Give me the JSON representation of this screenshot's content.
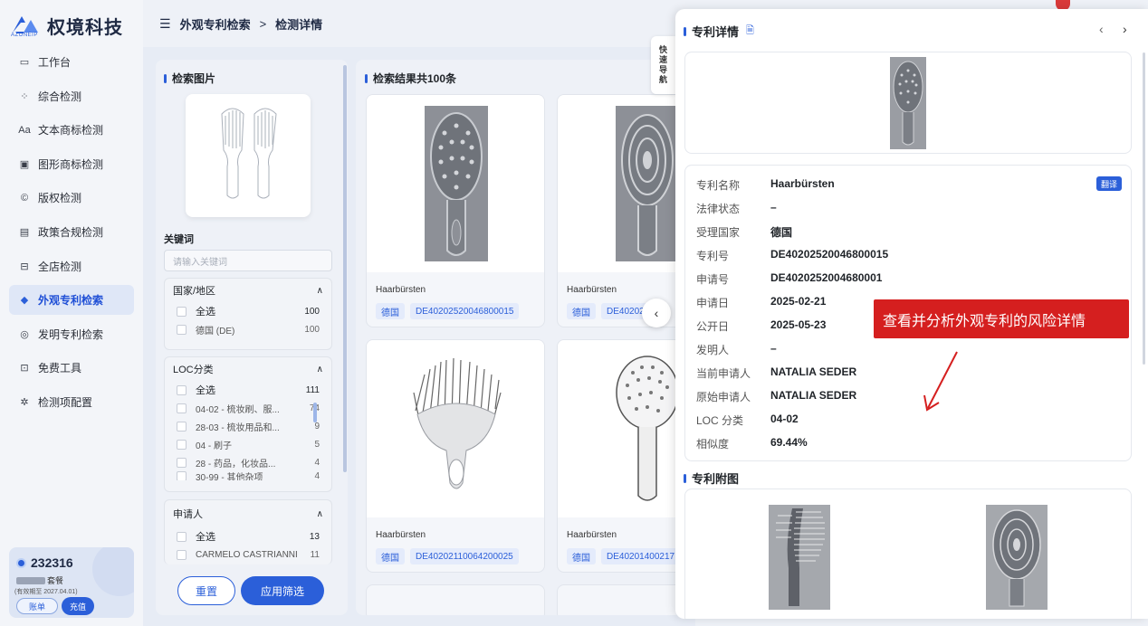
{
  "brand": {
    "name": "权境科技",
    "sub": "AZONEIP"
  },
  "breadcrumb": {
    "parent": "外观专利检索",
    "sep": ">",
    "current": "检测详情"
  },
  "nav": [
    {
      "label": "工作台",
      "icon": "monitor-icon"
    },
    {
      "label": "综合检测",
      "icon": "grid-icon"
    },
    {
      "label": "文本商标检测",
      "icon": "text-icon"
    },
    {
      "label": "图形商标检测",
      "icon": "image-icon"
    },
    {
      "label": "版权检测",
      "icon": "copyright-icon"
    },
    {
      "label": "政策合规检测",
      "icon": "policy-icon"
    },
    {
      "label": "全店检测",
      "icon": "store-icon"
    },
    {
      "label": "外观专利检索",
      "icon": "cube-icon",
      "active": true
    },
    {
      "label": "发明专利检索",
      "icon": "pin-icon"
    },
    {
      "label": "免费工具",
      "icon": "briefcase-icon"
    },
    {
      "label": "检测项配置",
      "icon": "settings-icon"
    }
  ],
  "account": {
    "id": "232316",
    "plan": "套餐",
    "expiry": "(有效期至 2027.04.01)",
    "bill": "账单",
    "recharge": "充值"
  },
  "filter": {
    "image_title": "检索图片",
    "keyword_label": "关键词",
    "keyword_placeholder": "请输入关键词",
    "groups": [
      {
        "title": "国家/地区",
        "options": [
          {
            "label": "全选",
            "count": "100"
          },
          {
            "label": "德国 (DE)",
            "count": "100"
          }
        ]
      },
      {
        "title": "LOC分类",
        "options": [
          {
            "label": "全选",
            "count": "111"
          },
          {
            "label": "04-02 - 梳妆刷、服...",
            "count": "74"
          },
          {
            "label": "28-03 - 梳妆用品和...",
            "count": "9"
          },
          {
            "label": "04 - 刷子",
            "count": "5"
          },
          {
            "label": "28 - 药品，化妆品...",
            "count": "4"
          },
          {
            "label": "30-99 - 其他杂项",
            "count": "4"
          }
        ]
      },
      {
        "title": "申请人",
        "options": [
          {
            "label": "全选",
            "count": "13"
          },
          {
            "label": "CARMELO CASTRIANNI",
            "count": "11"
          }
        ]
      }
    ],
    "reset": "重置",
    "apply": "应用筛选"
  },
  "results": {
    "title": "检索结果共100条",
    "cards": [
      {
        "name": "Haarbürsten",
        "country": "德国",
        "number": "DE40202520046800015"
      },
      {
        "name": "Haarbürsten",
        "country": "德国",
        "number": "DE40202"
      },
      {
        "name": "Haarbürsten",
        "country": "德国",
        "number": "DE40202110064200025"
      },
      {
        "name": "Haarbürsten",
        "country": "德国",
        "number": "DE40201400217"
      }
    ]
  },
  "quick_nav": [
    "快",
    "速",
    "导",
    "航"
  ],
  "detail": {
    "title": "专利详情",
    "translate": "翻译",
    "fields": [
      {
        "k": "专利名称",
        "v": "Haarbürsten"
      },
      {
        "k": "法律状态",
        "v": "–"
      },
      {
        "k": "受理国家",
        "v": "德国"
      },
      {
        "k": "专利号",
        "v": "DE40202520046800015"
      },
      {
        "k": "申请号",
        "v": "DE4020252004680001"
      },
      {
        "k": "申请日",
        "v": "2025-02-21"
      },
      {
        "k": "公开日",
        "v": "2025-05-23"
      },
      {
        "k": "发明人",
        "v": "–"
      },
      {
        "k": "当前申请人",
        "v": "NATALIA SEDER"
      },
      {
        "k": "原始申请人",
        "v": "NATALIA SEDER"
      },
      {
        "k": "LOC 分类",
        "v": "04-02"
      },
      {
        "k": "相似度",
        "v": "69.44%"
      }
    ],
    "annotation": "查看并分析外观专利的风险详情",
    "attachments_title": "专利附图"
  }
}
